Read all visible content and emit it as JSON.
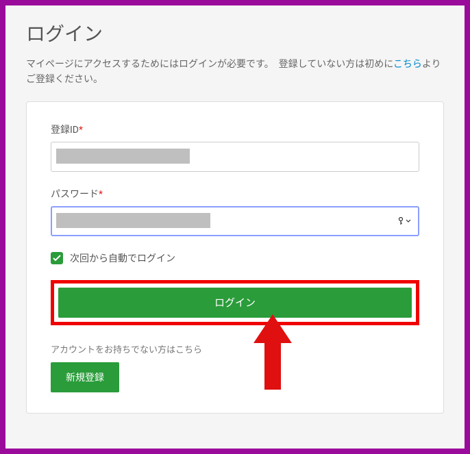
{
  "page": {
    "title": "ログイン",
    "intro_before": "マイページにアクセスするためにはログインが必要です。　登録していない方は初めに",
    "intro_link": "こちら",
    "intro_after": "よりご登録ください。"
  },
  "form": {
    "id_label": "登録ID",
    "password_label": "パスワード",
    "required_mark": "*",
    "remember_label": "次回から自動でログイン",
    "login_button": "ログイン",
    "signup_text": "アカウントをお持ちでない方はこちら",
    "signup_button": "新規登録"
  }
}
